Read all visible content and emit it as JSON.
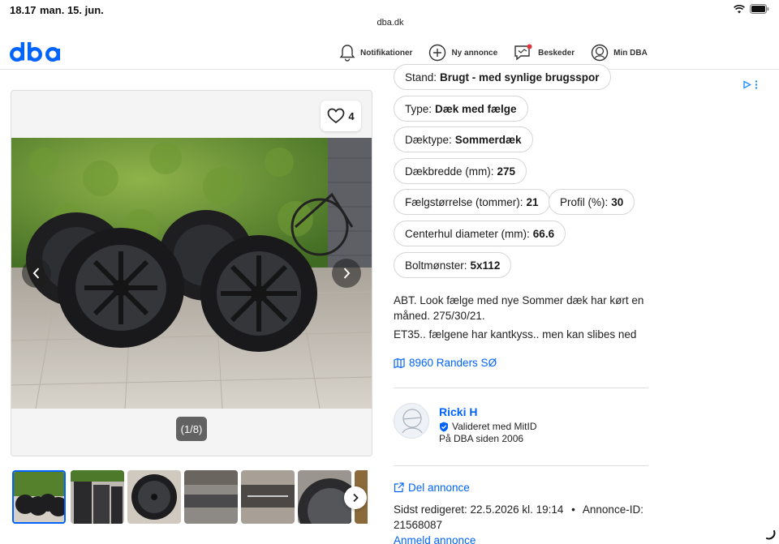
{
  "status_bar": {
    "time": "18.17",
    "date": "man. 15. jun.",
    "url": "dba.dk"
  },
  "header": {
    "logo": "dba",
    "nav": [
      {
        "label": "Notifikationer",
        "icon": "bell-icon"
      },
      {
        "label": "Ny annonce",
        "icon": "plus-circle-icon"
      },
      {
        "label": "Beskeder",
        "icon": "message-icon"
      },
      {
        "label": "Min DBA",
        "icon": "user-circle-icon"
      }
    ]
  },
  "gallery": {
    "favorites_count": "4",
    "counter": "(1/8)",
    "thumbnail_count": 7,
    "active_thumbnail": 1
  },
  "specs": [
    {
      "label": "Stand:",
      "value": "Brugt - med synlige brugsspor"
    },
    {
      "label": "Type:",
      "value": "Dæk med fælge"
    },
    {
      "label": "Dæktype:",
      "value": "Sommerdæk"
    },
    {
      "label": "Dækbredde (mm):",
      "value": "275"
    },
    {
      "label": "Fælgstørrelse (tommer):",
      "value": "21"
    },
    {
      "label": "Profil (%):",
      "value": "30"
    },
    {
      "label": "Centerhul diameter (mm):",
      "value": "66.6"
    },
    {
      "label": "Boltmønster:",
      "value": "5x112"
    }
  ],
  "description": {
    "line1": "ABT. Look fælge med nye Sommer dæk har kørt en måned. 275/30/21.",
    "line2": "ET35.. fælgene har kantkyss.. men kan slibes ned"
  },
  "location": "8960 Randers SØ",
  "seller": {
    "name": "Ricki H",
    "verified": "Valideret med MitID",
    "since": "På DBA siden 2006"
  },
  "actions": {
    "share": "Del annonce",
    "edited": "Sidst redigeret: 22.5.2026 kl. 19:14",
    "separator": "•",
    "ad_id": "Annonce-ID: 21568087",
    "report": "Anmeld annonce"
  },
  "colors": {
    "link": "#0063fb",
    "logo": "#0063fb",
    "notification_dot": "#e0323a"
  }
}
